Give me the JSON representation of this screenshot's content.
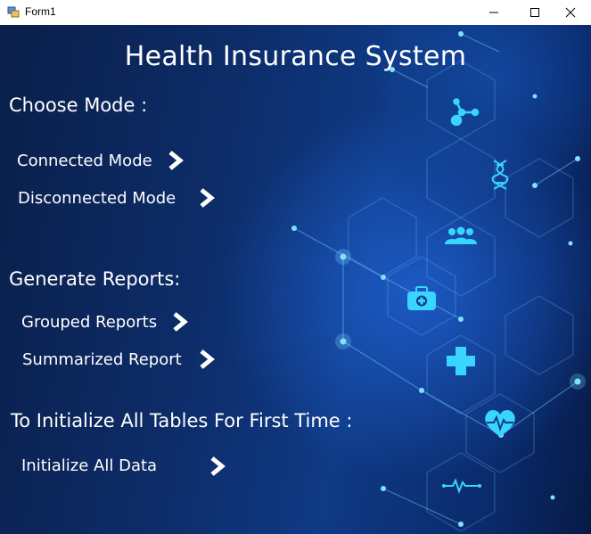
{
  "window": {
    "title": "Form1"
  },
  "header": {
    "title": "Health Insurance System"
  },
  "sections": {
    "choose_mode": {
      "label": "Choose Mode :",
      "connected": "Connected Mode",
      "disconnected": "Disconnected Mode"
    },
    "reports": {
      "label": "Generate Reports:",
      "grouped": "Grouped Reports",
      "summarized": "Summarized Report"
    },
    "init": {
      "label": "To Initialize All Tables For First Time :",
      "button": "Initialize All Data"
    }
  },
  "colors": {
    "accent": "#38d6ff",
    "text": "#ffffff"
  },
  "icons": [
    "molecule-icon",
    "dna-icon",
    "people-icon",
    "medical-kit-icon",
    "cross-icon",
    "heartbeat-icon",
    "pulse-line-icon"
  ]
}
